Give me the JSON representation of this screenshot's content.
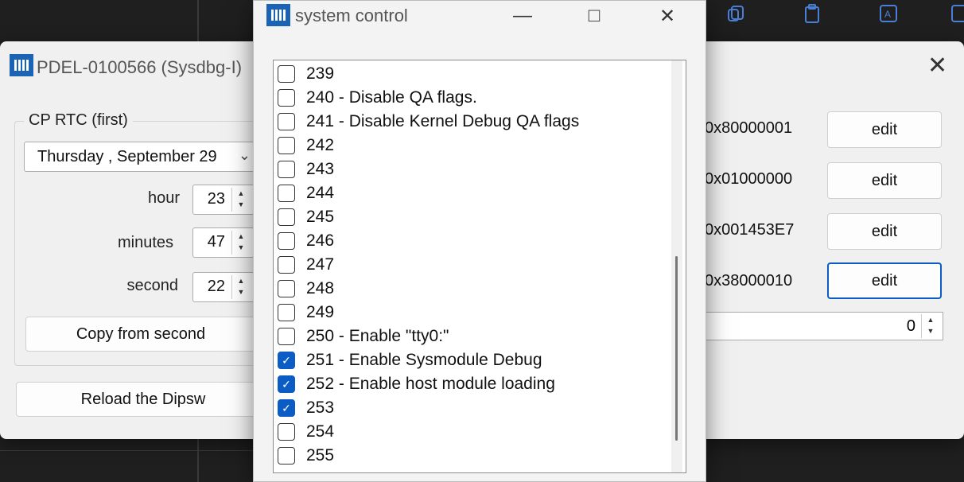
{
  "background": {
    "icons": [
      "copy-icon",
      "clipboard-icon",
      "text-box-icon",
      "text-icon"
    ]
  },
  "left_window": {
    "title": "PDEL-0100566 (Sysdbg-I)",
    "group_label": "CP RTC (first)",
    "date_value": "Thursday  , September 29",
    "hour_label": "hour",
    "hour_value": "23",
    "minutes_label": "minutes",
    "minutes_value": "47",
    "second_label": "second",
    "second_value": "22",
    "copy_button": "Copy from second",
    "reload_button": "Reload the Dipsw"
  },
  "center_window": {
    "title": "system control",
    "minimize": "—",
    "maximize": "□",
    "close": "✕",
    "items": [
      {
        "label": "239",
        "checked": false
      },
      {
        "label": "240 - Disable QA flags.",
        "checked": false
      },
      {
        "label": "241 - Disable Kernel Debug QA flags",
        "checked": false
      },
      {
        "label": "242",
        "checked": false
      },
      {
        "label": "243",
        "checked": false
      },
      {
        "label": "244",
        "checked": false
      },
      {
        "label": "245",
        "checked": false
      },
      {
        "label": "246",
        "checked": false
      },
      {
        "label": "247",
        "checked": false
      },
      {
        "label": "248",
        "checked": false
      },
      {
        "label": "249",
        "checked": false
      },
      {
        "label": "250 - Enable \"tty0:\"",
        "checked": false
      },
      {
        "label": "251 - Enable Sysmodule Debug",
        "checked": true
      },
      {
        "label": "252 - Enable host module loading",
        "checked": true
      },
      {
        "label": "253",
        "checked": true
      },
      {
        "label": "254",
        "checked": false
      },
      {
        "label": "255",
        "checked": false
      }
    ]
  },
  "right_window": {
    "close": "✕",
    "rows": [
      {
        "value": "0x80000001",
        "button": "edit"
      },
      {
        "value": "0x01000000",
        "button": "edit"
      },
      {
        "value": "0x001453E7",
        "button": "edit"
      },
      {
        "value": "0x38000010",
        "button": "edit"
      }
    ],
    "number_value": "0"
  },
  "colors": {
    "accent": "#0b5cc4",
    "app_icon": "#1a63b5"
  }
}
